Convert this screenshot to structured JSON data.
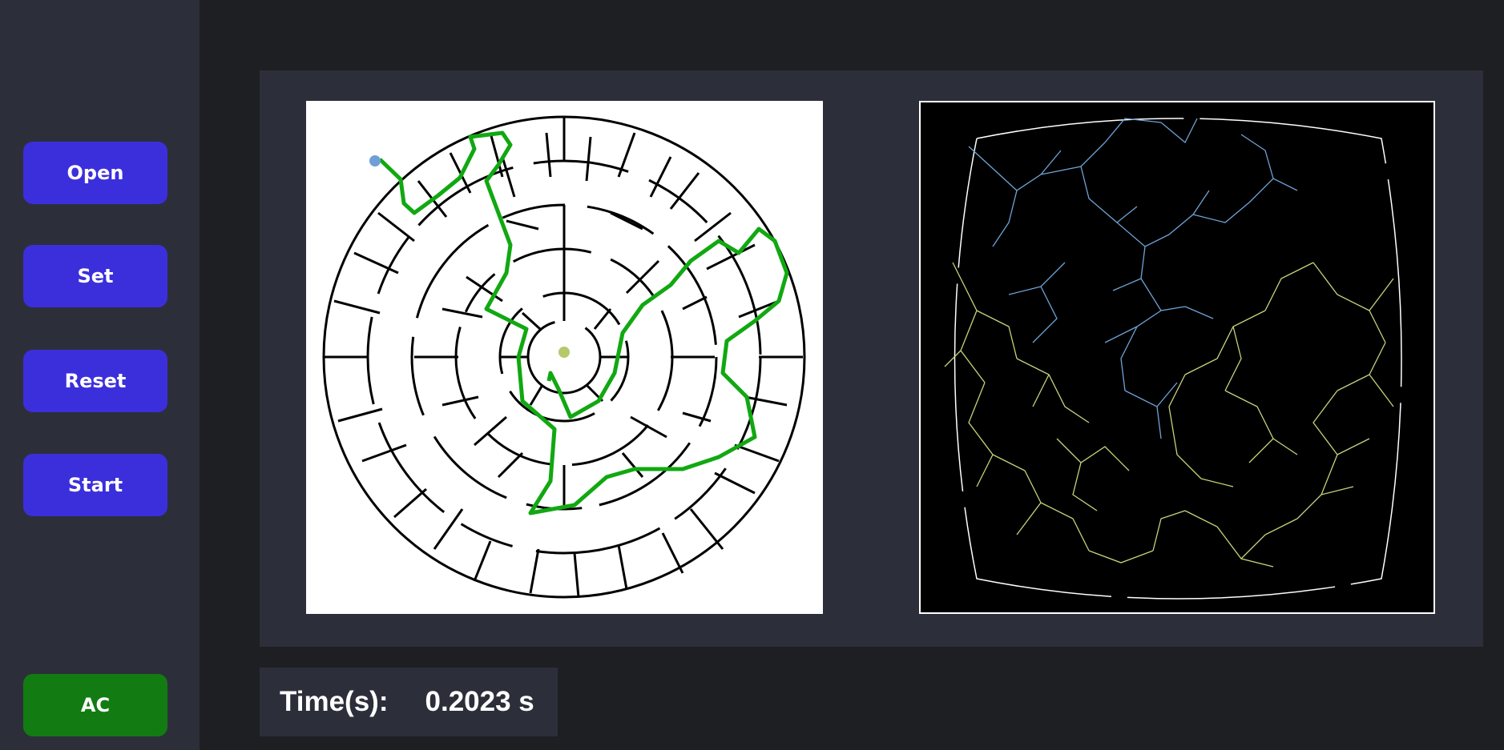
{
  "sidebar": {
    "buttons": {
      "open": "Open",
      "set": "Set",
      "reset": "Reset",
      "start": "Start",
      "ac": "AC"
    }
  },
  "status": {
    "time_label": "Time(s):",
    "time_value": "0.2023 s"
  },
  "colors": {
    "sidebar_bg": "#2c2f3a",
    "app_bg": "#1e1f23",
    "button": "#3b2fdc",
    "ac_button": "#127c12",
    "solution_path": "#11a811",
    "start_marker": "#6f9fd6",
    "goal_marker": "#b5c96a",
    "tree_blue": "#6fa3d6",
    "tree_yellow": "#c9d37a"
  },
  "icons": {
    "start_marker": "start-point-icon",
    "goal_marker": "goal-point-icon"
  }
}
